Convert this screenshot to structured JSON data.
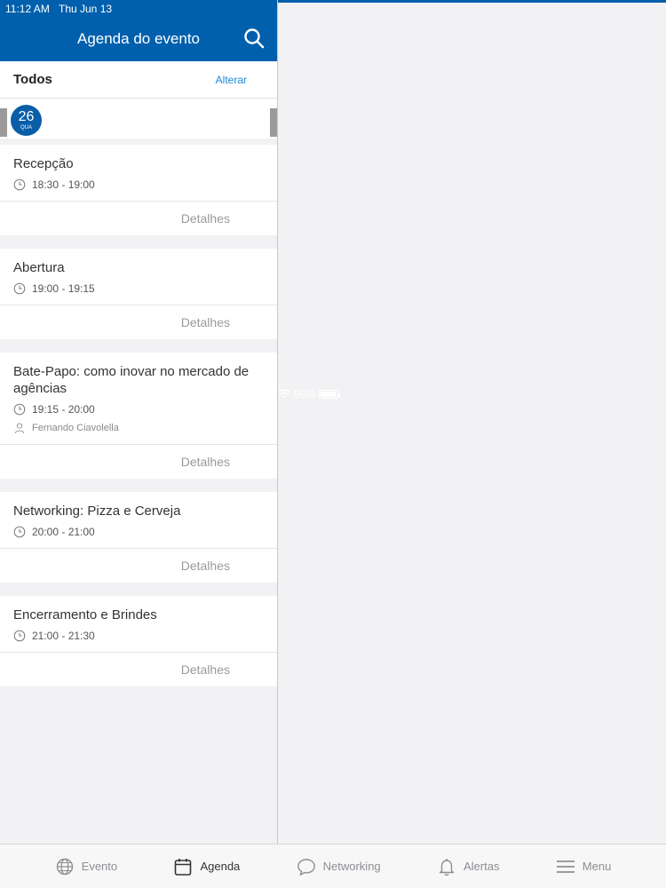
{
  "status_bar": {
    "time": "11:12 AM",
    "date": "Thu Jun 13",
    "battery": "96%",
    "battery_level": 0.96
  },
  "header": {
    "title": "Agenda do evento"
  },
  "filter": {
    "label": "Todos",
    "change_label": "Alterar"
  },
  "day": {
    "number": "26",
    "weekday": "QUA"
  },
  "sessions": [
    {
      "title": "Recepção",
      "time": "18:30 - 19:00",
      "speaker": "",
      "details_label": "Detalhes"
    },
    {
      "title": "Abertura",
      "time": "19:00 - 19:15",
      "speaker": "",
      "details_label": "Detalhes"
    },
    {
      "title": "Bate-Papo: como inovar no mercado de agências",
      "time": "19:15 - 20:00",
      "speaker": "Fernando Ciavolella",
      "details_label": "Detalhes"
    },
    {
      "title": "Networking: Pizza e Cerveja",
      "time": "20:00 - 21:00",
      "speaker": "",
      "details_label": "Detalhes"
    },
    {
      "title": "Encerramento e Brindes",
      "time": "21:00 - 21:30",
      "speaker": "",
      "details_label": "Detalhes"
    }
  ],
  "tabs": [
    {
      "label": "Evento",
      "icon": "globe-icon",
      "active": false
    },
    {
      "label": "Agenda",
      "icon": "calendar-icon",
      "active": true
    },
    {
      "label": "Networking",
      "icon": "chat-bubble-icon",
      "active": false
    },
    {
      "label": "Alertas",
      "icon": "bell-icon",
      "active": false
    },
    {
      "label": "Menu",
      "icon": "hamburger-menu-icon",
      "active": false
    }
  ],
  "colors": {
    "header": "#0060ad",
    "accent": "#1c88d6",
    "day_chip": "#0a5ea8"
  }
}
